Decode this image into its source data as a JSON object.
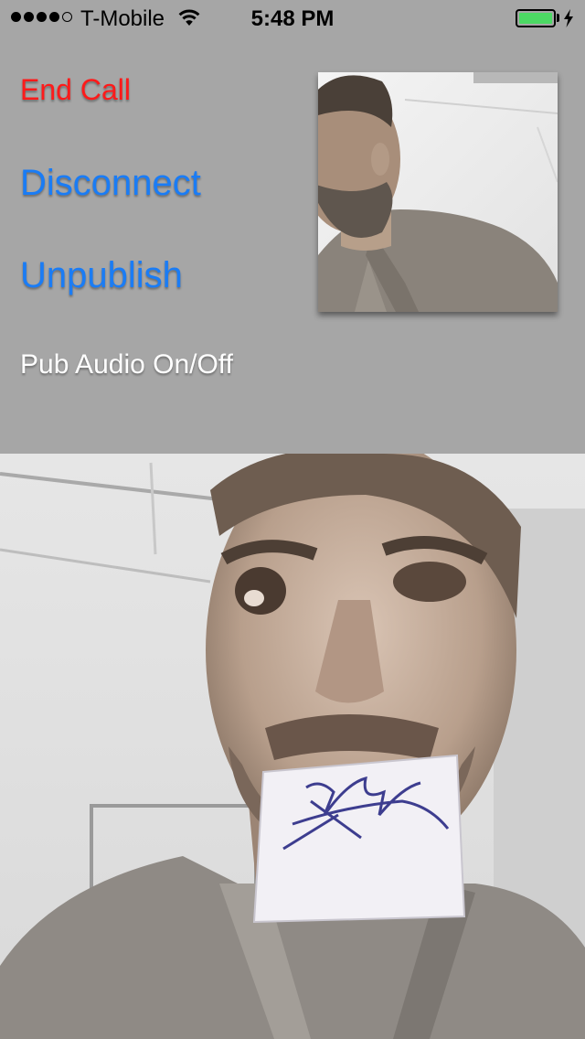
{
  "status_bar": {
    "signal_bars_filled": 4,
    "signal_bars_total": 5,
    "carrier": "T-Mobile",
    "time": "5:48 PM",
    "battery_level": 1.0,
    "charging": true,
    "icons": [
      "signal-dots",
      "wifi-icon",
      "battery-icon",
      "charging-bolt-icon"
    ]
  },
  "controls": {
    "end_call": "End Call",
    "disconnect": "Disconnect",
    "unpublish": "Unpublish",
    "pub_audio": "Pub Audio On/Off"
  },
  "colors": {
    "background": "#a6a6a6",
    "end_call": "#ff1a1a",
    "link": "#1a7cf5",
    "label": "#ffffff",
    "battery": "#4cd964"
  }
}
